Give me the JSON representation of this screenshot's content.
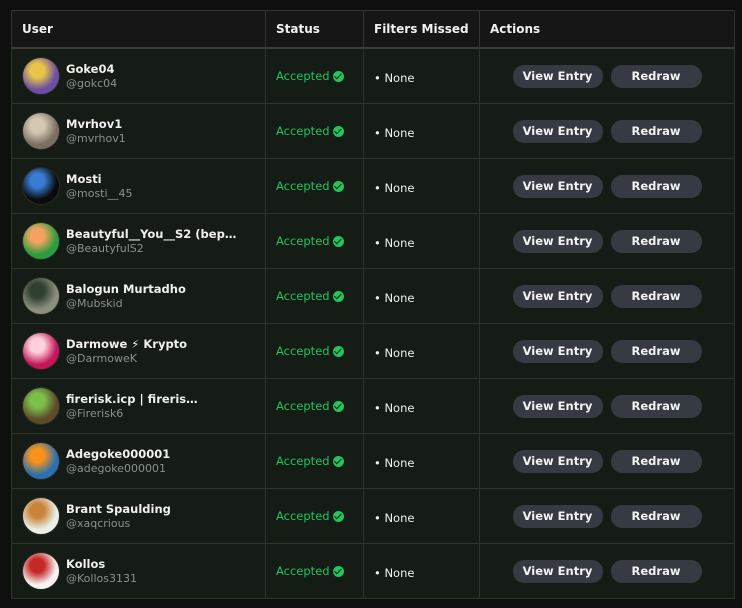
{
  "headers": {
    "user": "User",
    "status": "Status",
    "filters": "Filters Missed",
    "actions": "Actions"
  },
  "buttons": {
    "view": "View Entry",
    "redraw": "Redraw"
  },
  "colors": {
    "accepted": "#22c55e",
    "button_bg": "#363a42",
    "row_bg": "#141c15"
  },
  "rows": [
    {
      "name": "Goke04",
      "handle": "@gokc04",
      "status": "Accepted",
      "filters": "• None",
      "avatar_icon": "pixel-art-avatar",
      "avatar_bg": "#6b4fa3",
      "avatar_fg": "#e8c547"
    },
    {
      "name": "Mvrhov1",
      "handle": "@mvrhov1",
      "status": "Accepted",
      "filters": "• None",
      "avatar_icon": "photo-avatar",
      "avatar_bg": "#7c6f5f",
      "avatar_fg": "#d4c8b4"
    },
    {
      "name": "Mosti",
      "handle": "@mosti__45",
      "status": "Accepted",
      "filters": "• None",
      "avatar_icon": "black-cat-avatar",
      "avatar_bg": "#0b0b0b",
      "avatar_fg": "#3a7bd5"
    },
    {
      "name": "Beautyful__You__S2 (bep2…",
      "handle": "@BeautyfulS2",
      "status": "Accepted",
      "filters": "• None",
      "avatar_icon": "rainbow-avatar",
      "avatar_bg": "#2a9d3c",
      "avatar_fg": "#f4a261"
    },
    {
      "name": "Balogun Murtadho",
      "handle": "@Mubskid",
      "status": "Accepted",
      "filters": "• None",
      "avatar_icon": "person-photo-avatar",
      "avatar_bg": "#8a8f7e",
      "avatar_fg": "#30402f"
    },
    {
      "name": "Darmowe ⚡ Krypto",
      "handle": "@DarmoweK",
      "status": "Accepted",
      "filters": "• None",
      "avatar_icon": "cartoon-character-avatar",
      "avatar_bg": "#c2185b",
      "avatar_fg": "#ffd1dc"
    },
    {
      "name": "firerisk.icp | fireris…",
      "handle": "@Firerisk6",
      "status": "Accepted",
      "filters": "• None",
      "avatar_icon": "green-creature-avatar",
      "avatar_bg": "#5d4b2a",
      "avatar_fg": "#7cc04a"
    },
    {
      "name": "Adegoke000001",
      "handle": "@adegoke000001",
      "status": "Accepted",
      "filters": "• None",
      "avatar_icon": "bitcoin-avatar",
      "avatar_bg": "#2a6fb0",
      "avatar_fg": "#f7931a"
    },
    {
      "name": "Brant Spaulding",
      "handle": "@xaqcrious",
      "status": "Accepted",
      "filters": "• None",
      "avatar_icon": "dinosaur-avatar",
      "avatar_bg": "#e9efe7",
      "avatar_fg": "#c8853a"
    },
    {
      "name": "Kollos",
      "handle": "@Kollos3131",
      "status": "Accepted",
      "filters": "• None",
      "avatar_icon": "ninja-avatar",
      "avatar_bg": "#f4f4f4",
      "avatar_fg": "#c62828"
    }
  ]
}
